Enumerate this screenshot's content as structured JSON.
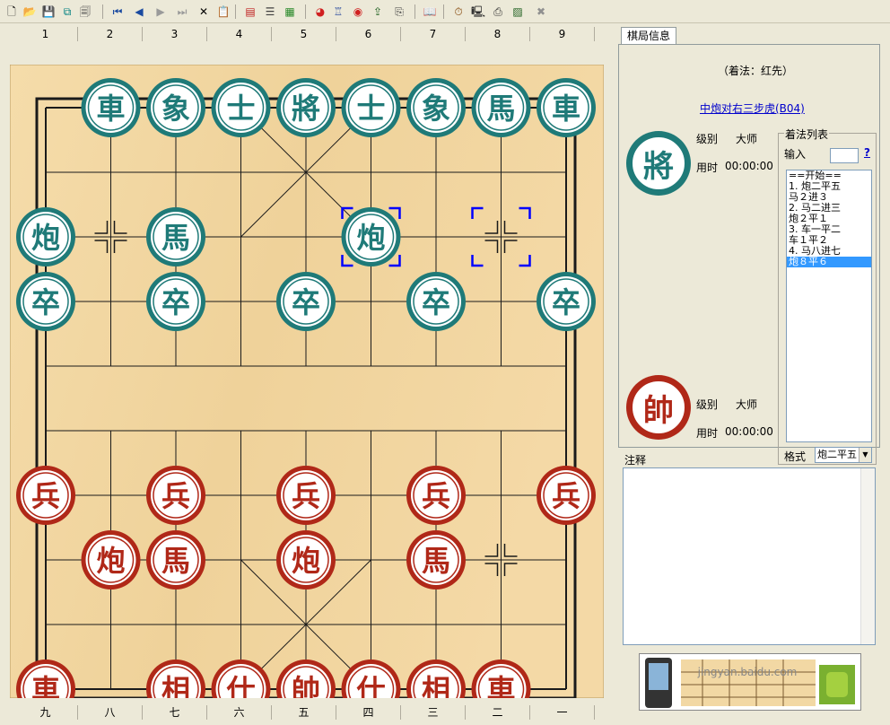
{
  "toolbar": {
    "buttons": [
      {
        "name": "new-file-icon",
        "glyph": "🗋",
        "color": "#000000"
      },
      {
        "name": "open-file-icon",
        "glyph": "📂",
        "color": "#c8a000"
      },
      {
        "name": "save-icon",
        "glyph": "💾",
        "color": "#1a1a80"
      },
      {
        "name": "save-as-icon",
        "glyph": "⧉",
        "color": "#008080"
      },
      {
        "name": "properties-icon",
        "glyph": "🗐",
        "color": "#444444"
      },
      {
        "name": "first-move-icon",
        "glyph": "⏮",
        "color": "#1a4aa0"
      },
      {
        "name": "previous-move-icon",
        "glyph": "◀",
        "color": "#1a4aa0"
      },
      {
        "name": "next-move-icon",
        "glyph": "▶",
        "color": "#9a9a9a"
      },
      {
        "name": "last-move-icon",
        "glyph": "⏭",
        "color": "#9a9a9a"
      },
      {
        "name": "delete-icon",
        "glyph": "✕",
        "color": "#000000"
      },
      {
        "name": "paste-icon",
        "glyph": "📋",
        "color": "#806000"
      },
      {
        "name": "edit-board-icon",
        "glyph": "▤",
        "color": "#c02020"
      },
      {
        "name": "move-tree-icon",
        "glyph": "☰",
        "color": "#404040"
      },
      {
        "name": "grid-icon",
        "glyph": "▦",
        "color": "#2a8a2a"
      },
      {
        "name": "engine-icon",
        "glyph": "◕",
        "color": "#d02020"
      },
      {
        "name": "analyze-icon",
        "glyph": "♖",
        "color": "#3050a0"
      },
      {
        "name": "weibo-icon",
        "glyph": "◉",
        "color": "#d02020"
      },
      {
        "name": "export-icon",
        "glyph": "⇪",
        "color": "#206020"
      },
      {
        "name": "import-icon",
        "glyph": "⎘",
        "color": "#404040"
      },
      {
        "name": "book-icon",
        "glyph": "📖",
        "color": "#3050a0"
      },
      {
        "name": "clock-icon",
        "glyph": "⏱",
        "color": "#804000"
      },
      {
        "name": "computer-icon",
        "glyph": "🖳",
        "color": "#303030"
      },
      {
        "name": "printer-icon",
        "glyph": "⎙",
        "color": "#303030"
      },
      {
        "name": "screenshot-icon",
        "glyph": "▨",
        "color": "#206020"
      },
      {
        "name": "close-icon",
        "glyph": "✖",
        "color": "#909090"
      }
    ]
  },
  "board": {
    "file_labels_top": [
      "1",
      "2",
      "3",
      "4",
      "5",
      "6",
      "7",
      "8",
      "9"
    ],
    "file_labels_bottom": [
      "九",
      "八",
      "七",
      "六",
      "五",
      "四",
      "三",
      "二",
      "一"
    ],
    "colors": {
      "board": "#f2d8a4",
      "line": "#1a1a1a",
      "black_piece": "#1f7a78",
      "red_piece": "#b02818",
      "piece_face": "#ffffff",
      "selection": "#0000ff"
    },
    "pieces": [
      {
        "char": "車",
        "side": "black",
        "file": 1,
        "rank": 0
      },
      {
        "char": "象",
        "side": "black",
        "file": 2,
        "rank": 0
      },
      {
        "char": "士",
        "side": "black",
        "file": 3,
        "rank": 0
      },
      {
        "char": "將",
        "side": "black",
        "file": 4,
        "rank": 0
      },
      {
        "char": "士",
        "side": "black",
        "file": 5,
        "rank": 0
      },
      {
        "char": "象",
        "side": "black",
        "file": 6,
        "rank": 0
      },
      {
        "char": "馬",
        "side": "black",
        "file": 7,
        "rank": 0
      },
      {
        "char": "車",
        "side": "black",
        "file": 8,
        "rank": 0
      },
      {
        "char": "炮",
        "side": "black",
        "file": 0,
        "rank": 2
      },
      {
        "char": "馬",
        "side": "black",
        "file": 2,
        "rank": 2
      },
      {
        "char": "炮",
        "side": "black",
        "file": 5,
        "rank": 2
      },
      {
        "char": "卒",
        "side": "black",
        "file": 0,
        "rank": 3
      },
      {
        "char": "卒",
        "side": "black",
        "file": 2,
        "rank": 3
      },
      {
        "char": "卒",
        "side": "black",
        "file": 4,
        "rank": 3
      },
      {
        "char": "卒",
        "side": "black",
        "file": 6,
        "rank": 3
      },
      {
        "char": "卒",
        "side": "black",
        "file": 8,
        "rank": 3
      },
      {
        "char": "兵",
        "side": "red",
        "file": 0,
        "rank": 6
      },
      {
        "char": "兵",
        "side": "red",
        "file": 2,
        "rank": 6
      },
      {
        "char": "兵",
        "side": "red",
        "file": 4,
        "rank": 6
      },
      {
        "char": "兵",
        "side": "red",
        "file": 6,
        "rank": 6
      },
      {
        "char": "兵",
        "side": "red",
        "file": 8,
        "rank": 6
      },
      {
        "char": "炮",
        "side": "red",
        "file": 1,
        "rank": 7
      },
      {
        "char": "馬",
        "side": "red",
        "file": 2,
        "rank": 7
      },
      {
        "char": "炮",
        "side": "red",
        "file": 4,
        "rank": 7
      },
      {
        "char": "馬",
        "side": "red",
        "file": 6,
        "rank": 7
      },
      {
        "char": "車",
        "side": "red",
        "file": 0,
        "rank": 9
      },
      {
        "char": "相",
        "side": "red",
        "file": 2,
        "rank": 9
      },
      {
        "char": "仕",
        "side": "red",
        "file": 3,
        "rank": 9
      },
      {
        "char": "帥",
        "side": "red",
        "file": 4,
        "rank": 9
      },
      {
        "char": "仕",
        "side": "red",
        "file": 5,
        "rank": 9
      },
      {
        "char": "相",
        "side": "red",
        "file": 6,
        "rank": 9
      },
      {
        "char": "車",
        "side": "red",
        "file": 7,
        "rank": 9
      }
    ],
    "selection_markers": [
      {
        "file": 5,
        "rank": 2
      },
      {
        "file": 7,
        "rank": 2
      }
    ],
    "position_marks": [
      {
        "file": 1,
        "rank": 2
      },
      {
        "file": 7,
        "rank": 2
      },
      {
        "file": 7,
        "rank": 7
      }
    ]
  },
  "side": {
    "tab_label": "棋局信息",
    "turn_label": "（着法：红先）",
    "opening_link": "中炮对右三步虎(B04)",
    "black_player": {
      "badge": "將",
      "level_label": "级别",
      "level_value": "大师",
      "time_label": "用时",
      "time_value": "00:00:00"
    },
    "red_player": {
      "badge": "帥",
      "level_label": "级别",
      "level_value": "大师",
      "time_label": "用时",
      "time_value": "00:00:00"
    },
    "move_list": {
      "title": "着法列表",
      "input_label": "输入",
      "help": "?",
      "items": [
        "==开始==",
        "1. 炮二平五",
        "   马２进３",
        "2. 马二进三",
        "   炮２平１",
        "3. 车一平二",
        "   车１平２",
        "4. 马八进七",
        "   炮８平６"
      ],
      "selected_index": 8,
      "format_label": "格式",
      "format_value": "炮二平五"
    },
    "notes_label": "注释",
    "ad_text": "jingyan.baidu.com"
  }
}
